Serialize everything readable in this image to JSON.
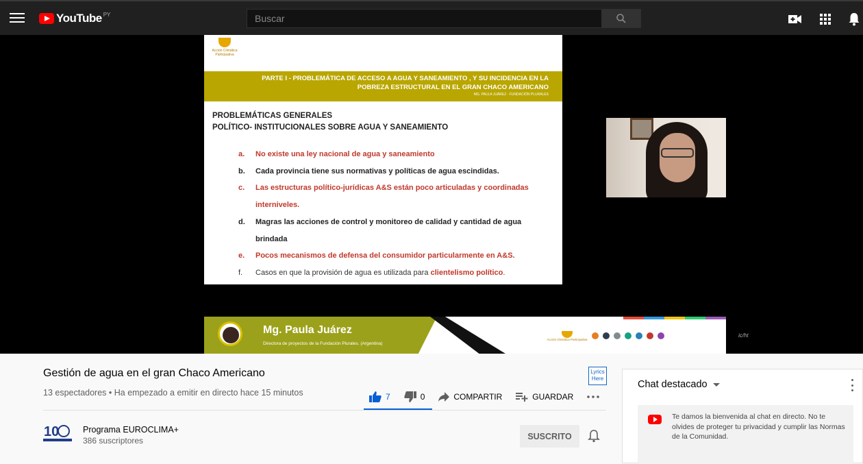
{
  "header": {
    "logo_text": "YouTube",
    "country_code": "PY",
    "search_placeholder": "Buscar"
  },
  "slide": {
    "logo_label": "Acción Climática Participativa",
    "banner_line1": "PARTE I - PROBLEMÁTICA DE ACCESO A AGUA Y SANEAMIENTO , Y SU INCIDENCIA EN LA",
    "banner_line2": "POBREZA ESTRUCTURAL EN EL GRAN CHACO AMERICANO",
    "banner_sub": "MG. PAULA JUÁREZ - FUNDACIÓN PLURALES",
    "heading_line1": "PROBLEMÁTICAS GENERALES",
    "heading_line2": "POLÍTICO- INSTITUCIONALES SOBRE AGUA Y SANEAMIENTO",
    "items": [
      {
        "letter": "a.",
        "text": "No existe una ley nacional de agua y saneamiento"
      },
      {
        "letter": "b.",
        "text": "Cada provincia tiene sus normativas y políticas de agua escindidas."
      },
      {
        "letter": "c.",
        "text": "Las estructuras político-jurídicas A&S están poco articuladas y coordinadas"
      },
      {
        "letter": "",
        "text": "interniveles."
      },
      {
        "letter": "d.",
        "text": "Magras las acciones de control y monitoreo de calidad y cantidad de agua"
      },
      {
        "letter": "",
        "text": "brindada"
      },
      {
        "letter": "e.",
        "text": "Pocos mecanismos de defensa del consumidor particularmente en A&S."
      },
      {
        "letter": "f.",
        "text_normal": "Casos en que la provisión de agua es utilizada para ",
        "text_red": "clientelismo político",
        "text_end": "."
      }
    ]
  },
  "lower_third": {
    "name": "Mg. Paula Juárez",
    "role": "Directora de proyectos de la Fundación Plurales. (Argentina)",
    "org_label": "Acción Climática Participativa",
    "watermark": "ic/ht"
  },
  "video_info": {
    "title": "Gestión de agua en el gran Chaco Americano",
    "meta": "13 espectadores • Ha empezado a emitir en directo hace 15 minutos",
    "lyrics_badge_line1": "Lyrics",
    "lyrics_badge_line2": "Here",
    "likes": "7",
    "dislikes": "0",
    "share_label": "COMPARTIR",
    "save_label": "GUARDAR"
  },
  "channel": {
    "name": "Programa EUROCLIMA+",
    "subscribers": "386 suscriptores",
    "subscribe_label": "SUSCRITO",
    "logo_text": "10"
  },
  "chat": {
    "header": "Chat destacado",
    "welcome": "Te damos la bienvenida al chat en directo. No te olvides de proteger tu privacidad y cumplir las Normas de la Comunidad."
  },
  "colors": {
    "brand_red": "#ff0000",
    "banner_olive": "#b9a600",
    "slide_red": "#c0392b",
    "like_blue": "#065fd4"
  }
}
